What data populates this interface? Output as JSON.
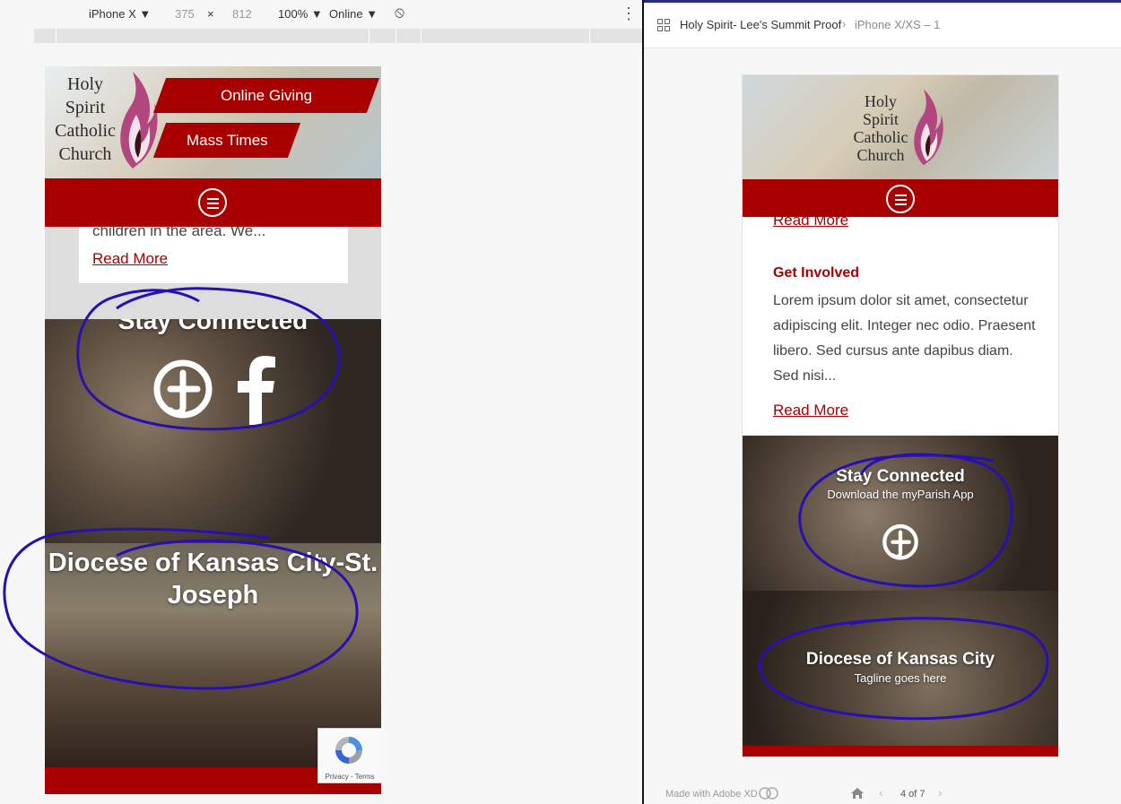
{
  "devtools": {
    "device": "iPhone X",
    "width": "375",
    "times": "×",
    "height": "812",
    "zoom": "100%",
    "throttle": "Online",
    "dropdown_arrow": "▼",
    "menu_dots": "⋮",
    "rotate_icon": "⦸"
  },
  "mobile": {
    "logo_lines": [
      "Holy",
      "Spirit",
      "Catholic",
      "Church"
    ],
    "online_giving": "Online Giving",
    "mass_times": "Mass Times",
    "card_excerpt": "children in the area. We...",
    "read_more": "Read More",
    "stay_connected": "Stay Connected",
    "diocese_title": "Diocese of Kansas City-St. Joseph",
    "recaptcha_text": "Privacy - Terms"
  },
  "xd": {
    "breadcrumb_project": "Holy Spirit- Lee's Summit Proof",
    "breadcrumb_sep": "›",
    "breadcrumb_artboard": "iPhone X/XS – 1",
    "read_more_top": "Read More",
    "get_involved": "Get Involved",
    "paragraph": "Lorem ipsum dolor sit amet, consectetur adipiscing elit. Integer nec odio. Praesent libero. Sed cursus ante dapibus diam. Sed nisi...",
    "read_more_bottom": "Read More",
    "stay_connected": "Stay Connected",
    "stay_subtitle": "Download the myParish App",
    "diocese_title": "Diocese of Kansas City",
    "diocese_tagline": "Tagline goes here",
    "made_with": "Made with Adobe XD",
    "page_indicator": "4 of 7"
  },
  "colors": {
    "brand_red": "#a80000",
    "annotation_ink": "#2a0fb0"
  }
}
